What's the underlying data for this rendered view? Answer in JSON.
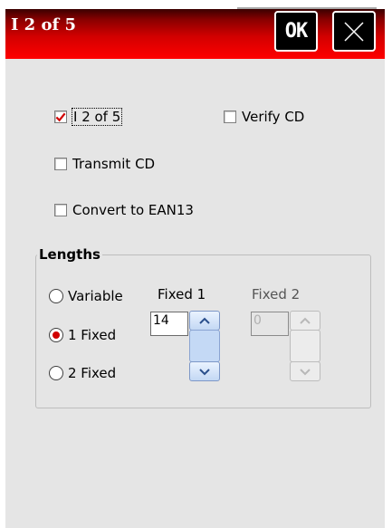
{
  "window": {
    "title": "I 2 of 5",
    "ok_label": "OK"
  },
  "options": {
    "i2of5": {
      "label": "I 2 of 5",
      "checked": true
    },
    "verify_cd": {
      "label": "Verify CD",
      "checked": false
    },
    "transmit_cd": {
      "label": "Transmit CD",
      "checked": false
    },
    "convert_ean13": {
      "label": "Convert to EAN13",
      "checked": false
    }
  },
  "lengths": {
    "group_label": "Lengths",
    "radios": [
      {
        "label": "Variable",
        "selected": false
      },
      {
        "label": "1 Fixed",
        "selected": true
      },
      {
        "label": "2 Fixed",
        "selected": false
      }
    ],
    "fixed1": {
      "label": "Fixed 1",
      "value": "14",
      "enabled": true
    },
    "fixed2": {
      "label": "Fixed 2",
      "value": "0",
      "enabled": false
    }
  },
  "colors": {
    "title_red": "#ff0000",
    "client_bg": "#e5e5e5",
    "check_red": "#d00000",
    "spinner_blue": "#c3d8f4"
  },
  "icons": {
    "close": "close-icon",
    "check": "checkmark-icon",
    "up": "chevron-up-icon",
    "down": "chevron-down-icon"
  }
}
